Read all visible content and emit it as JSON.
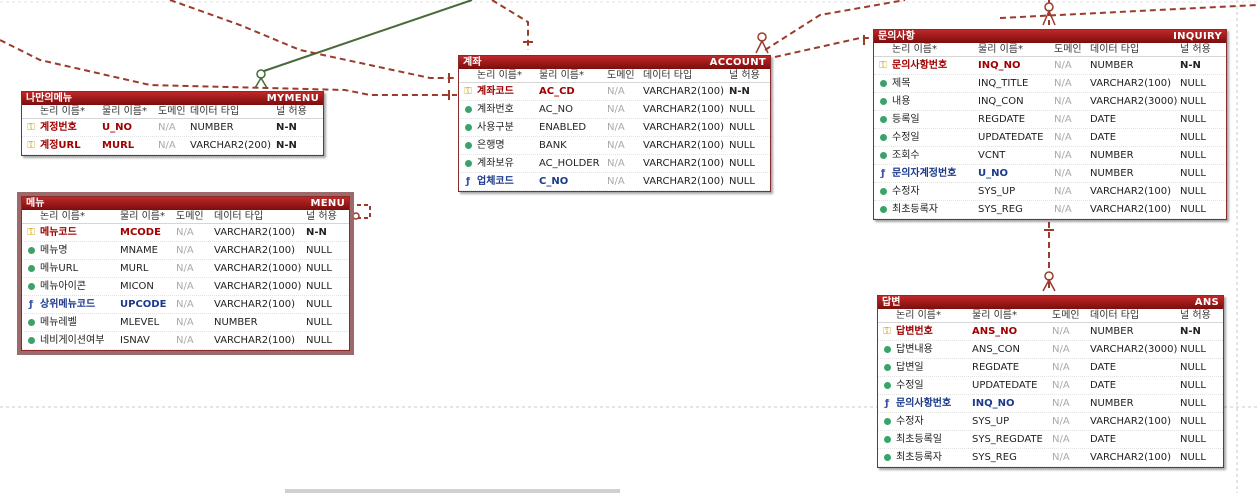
{
  "col_labels": {
    "logical": "논리 이름*",
    "physical": "물리 이름*",
    "domain": "도메인",
    "datatype": "데이터 타입",
    "nullable": "널 허용"
  },
  "entities": {
    "mymenu": {
      "logical": "나만의메뉴",
      "physical": "MYMENU",
      "rows": [
        {
          "icon": "pkfk",
          "type": "pk",
          "logical": "계정번호",
          "physical": "U_NO",
          "domain": "N/A",
          "datatype": "NUMBER",
          "nullable": "N-N"
        },
        {
          "icon": "key",
          "type": "pk",
          "logical": "계정URL",
          "physical": "MURL",
          "domain": "N/A",
          "datatype": "VARCHAR2(200)",
          "nullable": "N-N"
        }
      ]
    },
    "menu": {
      "logical": "메뉴",
      "physical": "MENU",
      "rows": [
        {
          "icon": "key",
          "type": "pk",
          "logical": "메뉴코드",
          "physical": "MCODE",
          "domain": "N/A",
          "datatype": "VARCHAR2(100)",
          "nullable": "N-N"
        },
        {
          "icon": "dot",
          "type": "attr",
          "logical": "메뉴명",
          "physical": "MNAME",
          "domain": "N/A",
          "datatype": "VARCHAR2(100)",
          "nullable": "NULL"
        },
        {
          "icon": "dot",
          "type": "attr",
          "logical": "메뉴URL",
          "physical": "MURL",
          "domain": "N/A",
          "datatype": "VARCHAR2(1000)",
          "nullable": "NULL"
        },
        {
          "icon": "dot",
          "type": "attr",
          "logical": "메뉴아이콘",
          "physical": "MICON",
          "domain": "N/A",
          "datatype": "VARCHAR2(1000)",
          "nullable": "NULL"
        },
        {
          "icon": "fk",
          "type": "fk",
          "logical": "상위메뉴코드",
          "physical": "UPCODE",
          "domain": "N/A",
          "datatype": "VARCHAR2(100)",
          "nullable": "NULL"
        },
        {
          "icon": "dot",
          "type": "attr",
          "logical": "메뉴레벨",
          "physical": "MLEVEL",
          "domain": "N/A",
          "datatype": "NUMBER",
          "nullable": "NULL"
        },
        {
          "icon": "dot",
          "type": "attr",
          "logical": "네비게이션여부",
          "physical": "ISNAV",
          "domain": "N/A",
          "datatype": "VARCHAR2(100)",
          "nullable": "NULL"
        }
      ]
    },
    "account": {
      "logical": "계좌",
      "physical": "ACCOUNT",
      "rows": [
        {
          "icon": "key",
          "type": "pk",
          "logical": "계좌코드",
          "physical": "AC_CD",
          "domain": "N/A",
          "datatype": "VARCHAR2(100)",
          "nullable": "N-N"
        },
        {
          "icon": "dot",
          "type": "attr",
          "logical": "계좌번호",
          "physical": "AC_NO",
          "domain": "N/A",
          "datatype": "VARCHAR2(100)",
          "nullable": "NULL"
        },
        {
          "icon": "dot",
          "type": "attr",
          "logical": "사용구분",
          "physical": "ENABLED",
          "domain": "N/A",
          "datatype": "VARCHAR2(100)",
          "nullable": "NULL"
        },
        {
          "icon": "dot",
          "type": "attr",
          "logical": "은행명",
          "physical": "BANK",
          "domain": "N/A",
          "datatype": "VARCHAR2(100)",
          "nullable": "NULL"
        },
        {
          "icon": "dot",
          "type": "attr",
          "logical": "계좌보유",
          "physical": "AC_HOLDER",
          "domain": "N/A",
          "datatype": "VARCHAR2(100)",
          "nullable": "NULL"
        },
        {
          "icon": "fk",
          "type": "fk",
          "logical": "업체코드",
          "physical": "C_NO",
          "domain": "N/A",
          "datatype": "VARCHAR2(100)",
          "nullable": "NULL"
        }
      ]
    },
    "inquiry": {
      "logical": "문의사항",
      "physical": "INQUIRY",
      "rows": [
        {
          "icon": "key",
          "type": "pk",
          "logical": "문의사항번호",
          "physical": "INQ_NO",
          "domain": "N/A",
          "datatype": "NUMBER",
          "nullable": "N-N"
        },
        {
          "icon": "dot",
          "type": "attr",
          "logical": "제목",
          "physical": "INQ_TITLE",
          "domain": "N/A",
          "datatype": "VARCHAR2(100)",
          "nullable": "NULL"
        },
        {
          "icon": "dot",
          "type": "attr",
          "logical": "내용",
          "physical": "INQ_CON",
          "domain": "N/A",
          "datatype": "VARCHAR2(3000)",
          "nullable": "NULL"
        },
        {
          "icon": "dot",
          "type": "attr",
          "logical": "등록일",
          "physical": "REGDATE",
          "domain": "N/A",
          "datatype": "DATE",
          "nullable": "NULL"
        },
        {
          "icon": "dot",
          "type": "attr",
          "logical": "수정일",
          "physical": "UPDATEDATE",
          "domain": "N/A",
          "datatype": "DATE",
          "nullable": "NULL"
        },
        {
          "icon": "dot",
          "type": "attr",
          "logical": "조회수",
          "physical": "VCNT",
          "domain": "N/A",
          "datatype": "NUMBER",
          "nullable": "NULL"
        },
        {
          "icon": "fk",
          "type": "fk",
          "logical": "문의자계정번호",
          "physical": "U_NO",
          "domain": "N/A",
          "datatype": "NUMBER",
          "nullable": "NULL"
        },
        {
          "icon": "dot",
          "type": "attr",
          "logical": "수정자",
          "physical": "SYS_UP",
          "domain": "N/A",
          "datatype": "VARCHAR2(100)",
          "nullable": "NULL"
        },
        {
          "icon": "dot",
          "type": "attr",
          "logical": "최초등록자",
          "physical": "SYS_REG",
          "domain": "N/A",
          "datatype": "VARCHAR2(100)",
          "nullable": "NULL"
        }
      ]
    },
    "ans": {
      "logical": "답변",
      "physical": "ANS",
      "rows": [
        {
          "icon": "key",
          "type": "pk",
          "logical": "답변번호",
          "physical": "ANS_NO",
          "domain": "N/A",
          "datatype": "NUMBER",
          "nullable": "N-N"
        },
        {
          "icon": "dot",
          "type": "attr",
          "logical": "답변내용",
          "physical": "ANS_CON",
          "domain": "N/A",
          "datatype": "VARCHAR2(3000)",
          "nullable": "NULL"
        },
        {
          "icon": "dot",
          "type": "attr",
          "logical": "답변일",
          "physical": "REGDATE",
          "domain": "N/A",
          "datatype": "DATE",
          "nullable": "NULL"
        },
        {
          "icon": "dot",
          "type": "attr",
          "logical": "수정일",
          "physical": "UPDATEDATE",
          "domain": "N/A",
          "datatype": "DATE",
          "nullable": "NULL"
        },
        {
          "icon": "fk",
          "type": "fk",
          "logical": "문의사항번호",
          "physical": "INQ_NO",
          "domain": "N/A",
          "datatype": "NUMBER",
          "nullable": "NULL"
        },
        {
          "icon": "dot",
          "type": "attr",
          "logical": "수정자",
          "physical": "SYS_UP",
          "domain": "N/A",
          "datatype": "VARCHAR2(100)",
          "nullable": "NULL"
        },
        {
          "icon": "dot",
          "type": "attr",
          "logical": "최초등록일",
          "physical": "SYS_REGDATE",
          "domain": "N/A",
          "datatype": "DATE",
          "nullable": "NULL"
        },
        {
          "icon": "dot",
          "type": "attr",
          "logical": "최초등록자",
          "physical": "SYS_REG",
          "domain": "N/A",
          "datatype": "VARCHAR2(100)",
          "nullable": "NULL"
        }
      ]
    }
  },
  "colors": {
    "relation_dashed": "#9a3b2b",
    "relation_identifying": "#4a6a3a",
    "grid": "#c8c8c8"
  }
}
